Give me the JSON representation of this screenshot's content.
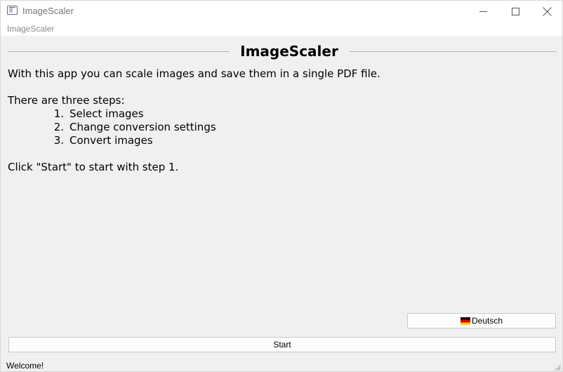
{
  "window": {
    "title": "ImageScaler",
    "menu_label": "ImageScaler"
  },
  "main": {
    "heading": "ImageScaler",
    "intro": "With this app you can scale images and save them in a single PDF file.",
    "steps_label": "There are three steps:",
    "steps": [
      {
        "number": "1.",
        "text": "Select images"
      },
      {
        "number": "2.",
        "text": "Change conversion settings"
      },
      {
        "number": "3.",
        "text": "Convert images"
      }
    ],
    "click_hint": "Click \"Start\" to start with step 1."
  },
  "buttons": {
    "language_label": "Deutsch",
    "language_flag_icon": "german-flag-icon",
    "start_label": "Start"
  },
  "status": {
    "text": "Welcome!"
  },
  "icons": {
    "app": "app-window-icon",
    "minimize": "minimize-icon",
    "maximize": "maximize-icon",
    "close": "close-icon",
    "grip": "resize-grip-icon"
  }
}
